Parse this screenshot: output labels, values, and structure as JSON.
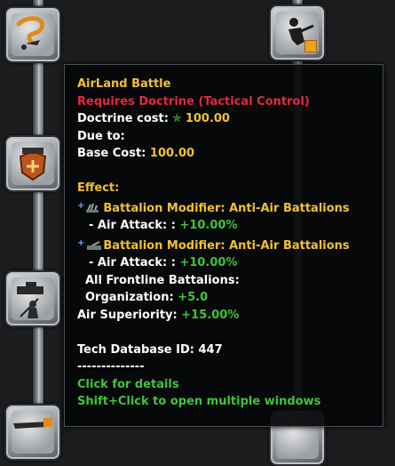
{
  "tooltip": {
    "title": "AirLand Battle",
    "requirement": "Requires Doctrine (Tactical Control)",
    "doctrine_cost_label": "Doctrine cost:",
    "doctrine_cost_value": "100.00",
    "due_to_label": "Due to:",
    "base_cost_label": "Base Cost:",
    "base_cost_value": "100.00",
    "effect_label": "Effect:",
    "modifier1_title": "Battalion Modifier: Anti-Air Battalions",
    "modifier1_stat_label": "- Air Attack: :",
    "modifier1_stat_value": "+10.00%",
    "modifier2_title": "Battalion Modifier: Anti-Air Battalions",
    "modifier2_stat_label": "- Air Attack: :",
    "modifier2_stat_value": "+10.00%",
    "frontline_label": "All Frontline Battalions:",
    "organization_label": "Organization:",
    "organization_value": "+5.0",
    "air_superiority_label": "Air Superiority:",
    "air_superiority_value": "+15.00%",
    "tech_id_label": "Tech Database ID:",
    "tech_id_value": "447",
    "separator": "--------------",
    "hint_details": "Click for details",
    "hint_multi": "Shift+Click to open multiple windows"
  },
  "colors": {
    "title": "#f2c12e",
    "requirement": "#e8283a",
    "positive": "#3ec53a",
    "text": "#ffffff",
    "tooltip_bg": "#050607"
  },
  "icons": [
    "airland-battle-icon",
    "infantry-tech-icon",
    "shield-tank-icon",
    "tank-infantry-icon",
    "airplane-tech-icon",
    "anti-air-gun-icon",
    "doctrine-star-icon"
  ]
}
